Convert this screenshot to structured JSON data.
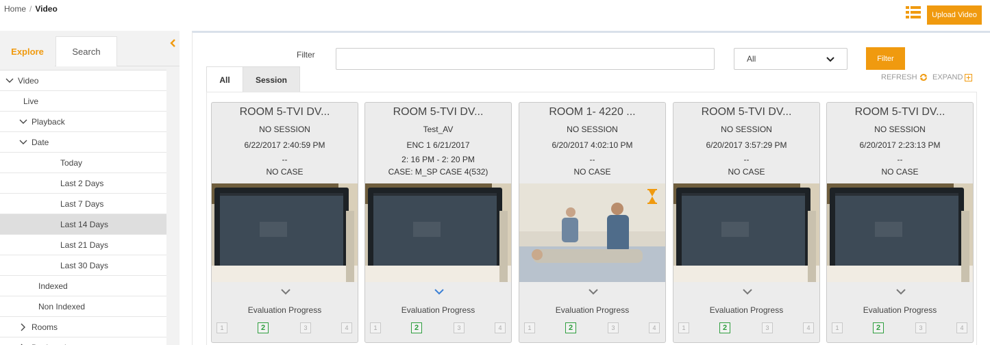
{
  "breadcrumb": {
    "home": "Home",
    "separator": "/",
    "current": "Video"
  },
  "header": {
    "upload_label": "Upload Video",
    "list_icon": "list-view-icon"
  },
  "sidebar": {
    "tabs": {
      "explore": "Explore",
      "search": "Search"
    },
    "tree": [
      {
        "label": "Video",
        "chevron": "down",
        "indent": 0
      },
      {
        "label": "Live",
        "chevron": "none",
        "indent": 1
      },
      {
        "label": "Playback",
        "chevron": "down",
        "indent": 1
      },
      {
        "label": "Date",
        "chevron": "down",
        "indent": 2
      },
      {
        "label": "Today",
        "chevron": "none",
        "indent": 3
      },
      {
        "label": "Last 2 Days",
        "chevron": "none",
        "indent": 3
      },
      {
        "label": "Last 7 Days",
        "chevron": "none",
        "indent": 3
      },
      {
        "label": "Last 14 Days",
        "chevron": "none",
        "indent": 3,
        "selected": true
      },
      {
        "label": "Last 21 Days",
        "chevron": "none",
        "indent": 3
      },
      {
        "label": "Last 30 Days",
        "chevron": "none",
        "indent": 3
      },
      {
        "label": "Indexed",
        "chevron": "none",
        "indent": 2
      },
      {
        "label": "Non Indexed",
        "chevron": "none",
        "indent": 2
      },
      {
        "label": "Rooms",
        "chevron": "right",
        "indent": 2
      },
      {
        "label": "Bookmarks",
        "chevron": "right",
        "indent": 2
      }
    ]
  },
  "filter": {
    "label": "Filter",
    "input_value": "",
    "select_value": "All",
    "button_label": "Filter",
    "refresh_label": "REFRESH",
    "expand_label": "EXPAND"
  },
  "tabs": {
    "all": "All",
    "session": "Session"
  },
  "cards": [
    {
      "title": "ROOM 5-TVI DV...",
      "session": "NO SESSION",
      "date": "6/22/2017 2:40:59 PM",
      "extra": "--",
      "case": "NO CASE",
      "thumb": "monitor",
      "evaluation_label": "Evaluation Progress",
      "steps": [
        "1",
        "2",
        "3",
        "4"
      ],
      "active_step": "2"
    },
    {
      "title": "ROOM 5-TVI DV...",
      "session": "Test_AV",
      "date": "ENC 1 6/21/2017",
      "extra": "2: 16 PM - 2: 20 PM",
      "case": "CASE: M_SP CASE 4(532)",
      "thumb": "monitor",
      "evaluation_label": "Evaluation Progress",
      "steps": [
        "1",
        "2",
        "3",
        "4"
      ],
      "active_step": "2"
    },
    {
      "title": "ROOM 1- 4220 ...",
      "session": "NO SESSION",
      "date": "6/20/2017 4:02:10 PM",
      "extra": "--",
      "case": "NO CASE",
      "thumb": "clinic",
      "processing": true,
      "evaluation_label": "Evaluation Progress",
      "steps": [
        "1",
        "2",
        "3",
        "4"
      ],
      "active_step": "2"
    },
    {
      "title": "ROOM 5-TVI DV...",
      "session": "NO SESSION",
      "date": "6/20/2017 3:57:29 PM",
      "extra": "--",
      "case": "NO CASE",
      "thumb": "monitor",
      "evaluation_label": "Evaluation Progress",
      "steps": [
        "1",
        "2",
        "3",
        "4"
      ],
      "active_step": "2"
    },
    {
      "title": "ROOM 5-TVI DV...",
      "session": "NO SESSION",
      "date": "6/20/2017 2:23:13 PM",
      "extra": "--",
      "case": "NO CASE",
      "thumb": "monitor",
      "evaluation_label": "Evaluation Progress",
      "steps": [
        "1",
        "2",
        "3",
        "4"
      ],
      "active_step": "2"
    }
  ],
  "colors": {
    "accent": "#f09a0f",
    "active_step": "#2e9e3e",
    "expand_chevron_active": "#3a7fd5",
    "refresh_icon": "#f09a0f"
  }
}
